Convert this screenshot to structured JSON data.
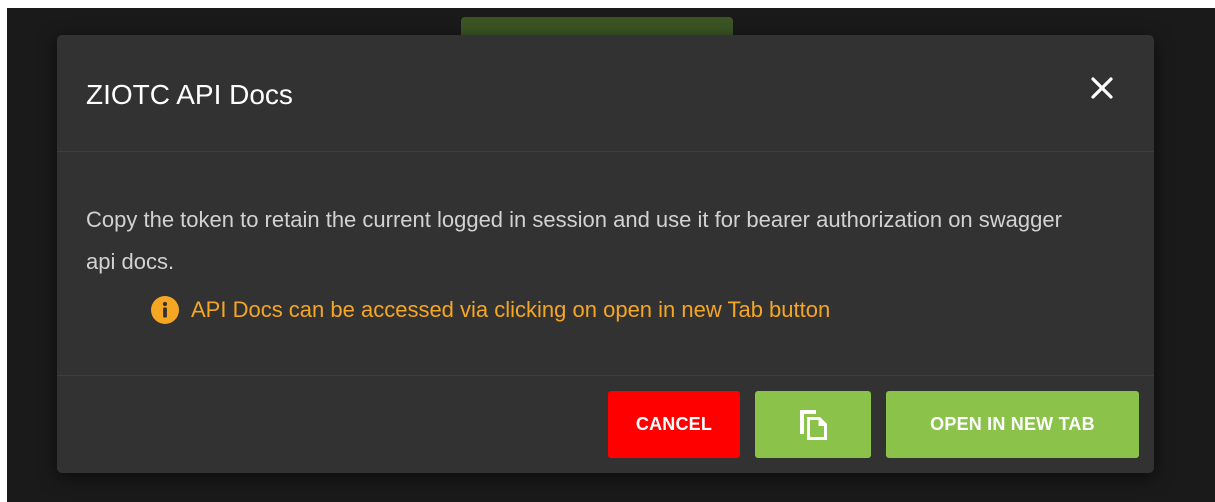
{
  "modal": {
    "title": "ZIOTC API Docs",
    "body_text": "Copy the token to retain the current logged in session and use it for bearer authorization on swagger api docs.",
    "info_text": "API Docs can be accessed via clicking on open in new Tab button"
  },
  "buttons": {
    "cancel_label": "CANCEL",
    "copy_icon": "copy-icon",
    "open_label": "OPEN IN NEW TAB"
  },
  "icons": {
    "close": "close-icon",
    "info": "info-icon"
  },
  "colors": {
    "modal_bg": "#323232",
    "backdrop": "#1a1a1a",
    "cancel": "#ff0000",
    "primary": "#8bc34a",
    "warning": "#f5a623"
  }
}
